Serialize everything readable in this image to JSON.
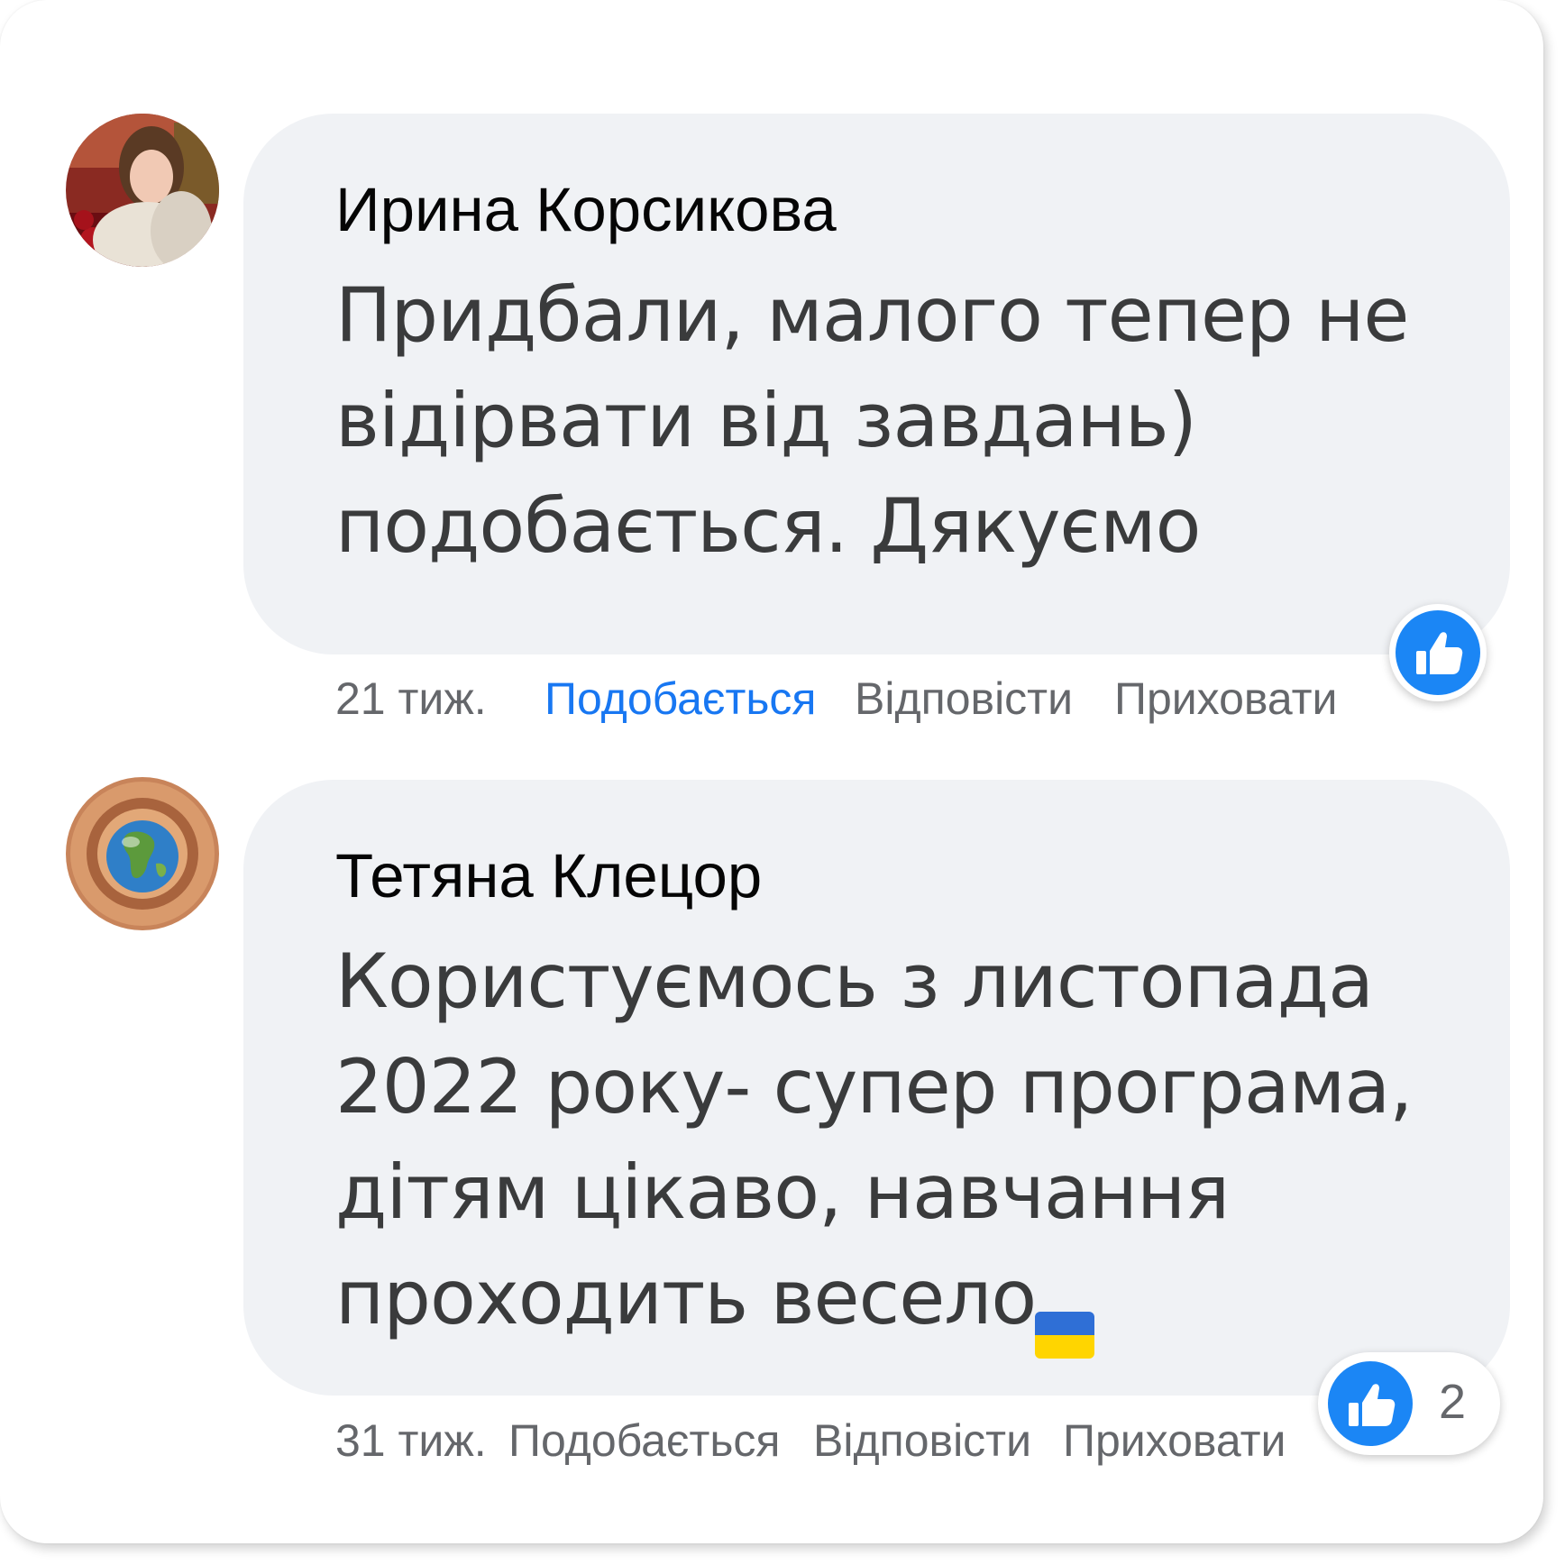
{
  "comments": [
    {
      "author": "Ирина Корсикова",
      "text_lines": [
        "Придбали, малого тепер не",
        "відірвати від завдань)",
        "подобається. Дякуємо"
      ],
      "time": "21 тиж.",
      "actions": {
        "like": "Подобається",
        "reply": "Відповісти",
        "hide": "Приховати"
      },
      "like_active": true,
      "reactions": {
        "icon": "thumbs-up-icon",
        "count": ""
      }
    },
    {
      "author": "Тетяна Клецор",
      "text_lines": [
        "Користуємось з листопада",
        "2022 року- супер програма,",
        "дітям цікаво, навчання",
        "проходить весело"
      ],
      "emoji": "ukraine-flag-icon",
      "time": "31 тиж.",
      "actions": {
        "like": "Подобається",
        "reply": "Відповісти",
        "hide": "Приховати"
      },
      "like_active": false,
      "reactions": {
        "icon": "thumbs-up-icon",
        "count": "2"
      }
    }
  ],
  "colors": {
    "bubble": "#f0f2f5",
    "accent": "#1877f2",
    "reaction_blue": "#1b86f5",
    "meta_text": "#65676b",
    "flag_blue": "#2f6fd6",
    "flag_yellow": "#ffd500"
  }
}
